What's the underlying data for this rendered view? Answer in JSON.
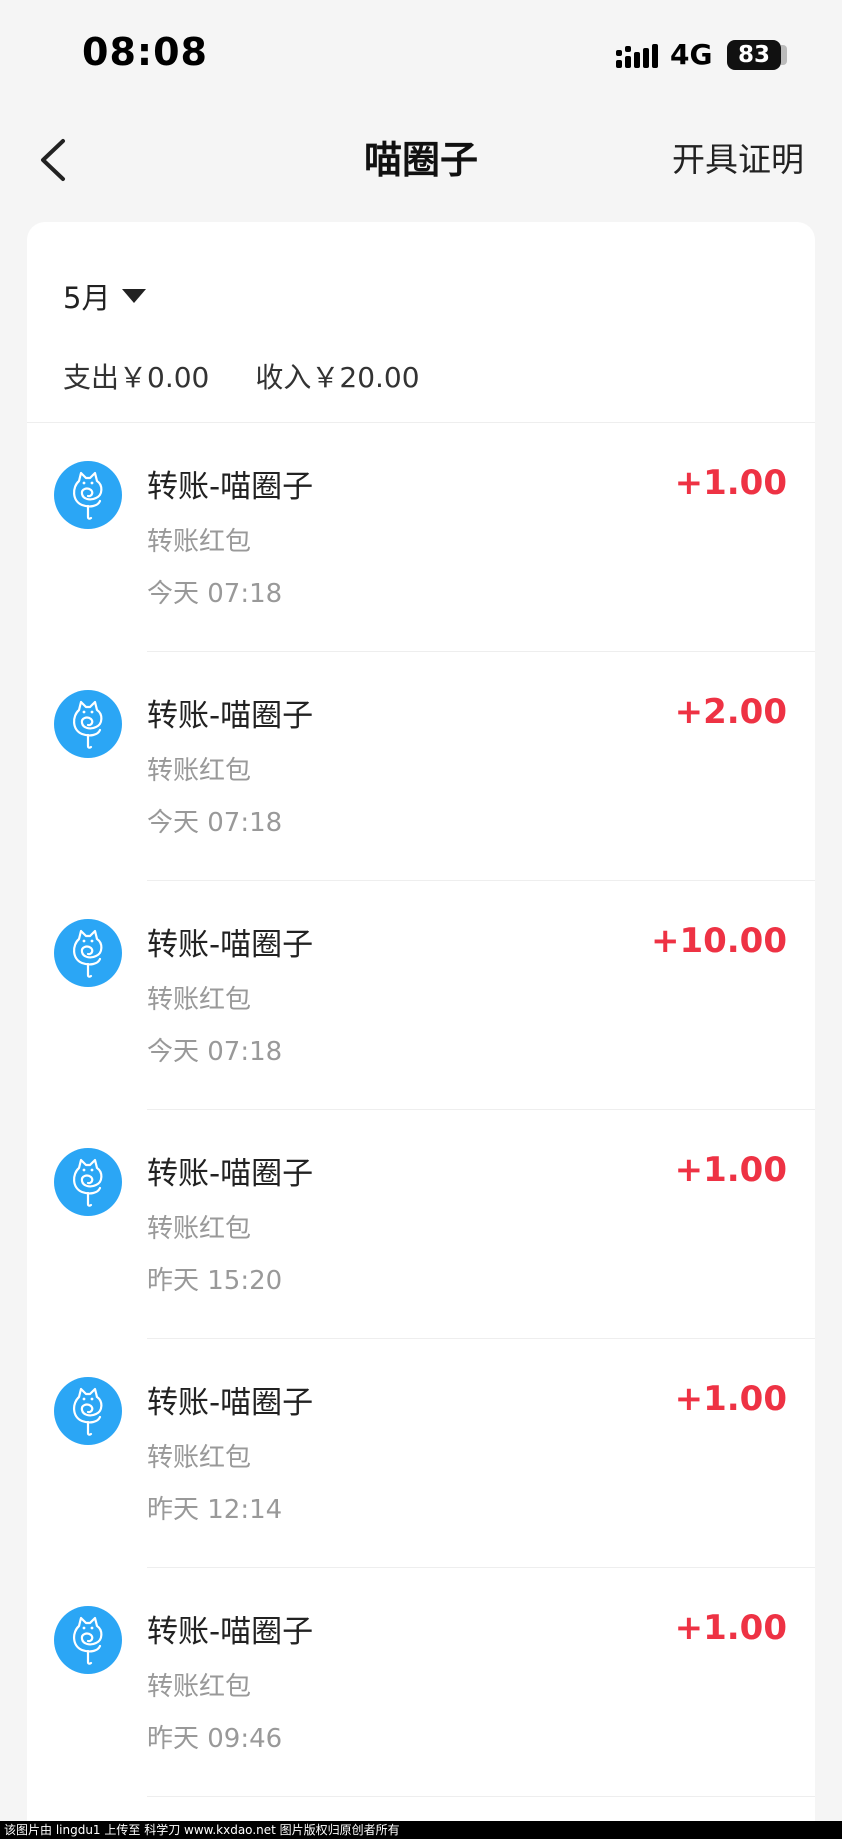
{
  "status_bar": {
    "time": "08:08",
    "network": "4G",
    "battery": "83"
  },
  "header": {
    "title": "喵圈子",
    "back_icon": "chevron-left-icon",
    "action_label": "开具证明"
  },
  "filter": {
    "month": "5月",
    "dropdown_icon": "caret-down-icon"
  },
  "summary": {
    "expense_label": "支出",
    "expense_value": "￥0.00",
    "income_label": "收入",
    "income_value": "￥20.00"
  },
  "transactions": [
    {
      "title": "转账-喵圈子",
      "subtitle": "转账红包",
      "time": "今天 07:18",
      "amount": "+1.00"
    },
    {
      "title": "转账-喵圈子",
      "subtitle": "转账红包",
      "time": "今天 07:18",
      "amount": "+2.00"
    },
    {
      "title": "转账-喵圈子",
      "subtitle": "转账红包",
      "time": "今天 07:18",
      "amount": "+10.00"
    },
    {
      "title": "转账-喵圈子",
      "subtitle": "转账红包",
      "time": "昨天 15:20",
      "amount": "+1.00"
    },
    {
      "title": "转账-喵圈子",
      "subtitle": "转账红包",
      "time": "昨天 12:14",
      "amount": "+1.00"
    },
    {
      "title": "转账-喵圈子",
      "subtitle": "转账红包",
      "time": "昨天 09:46",
      "amount": "+1.00"
    }
  ],
  "colors": {
    "income_amount": "#ee3244",
    "avatar_bg": "#2ba6f5",
    "page_bg": "#f5f5f5"
  },
  "footer": {
    "watermark": "该图片由 lingdu1 上传至 科学刀 www.kxdao.net 图片版权归原创者所有"
  }
}
